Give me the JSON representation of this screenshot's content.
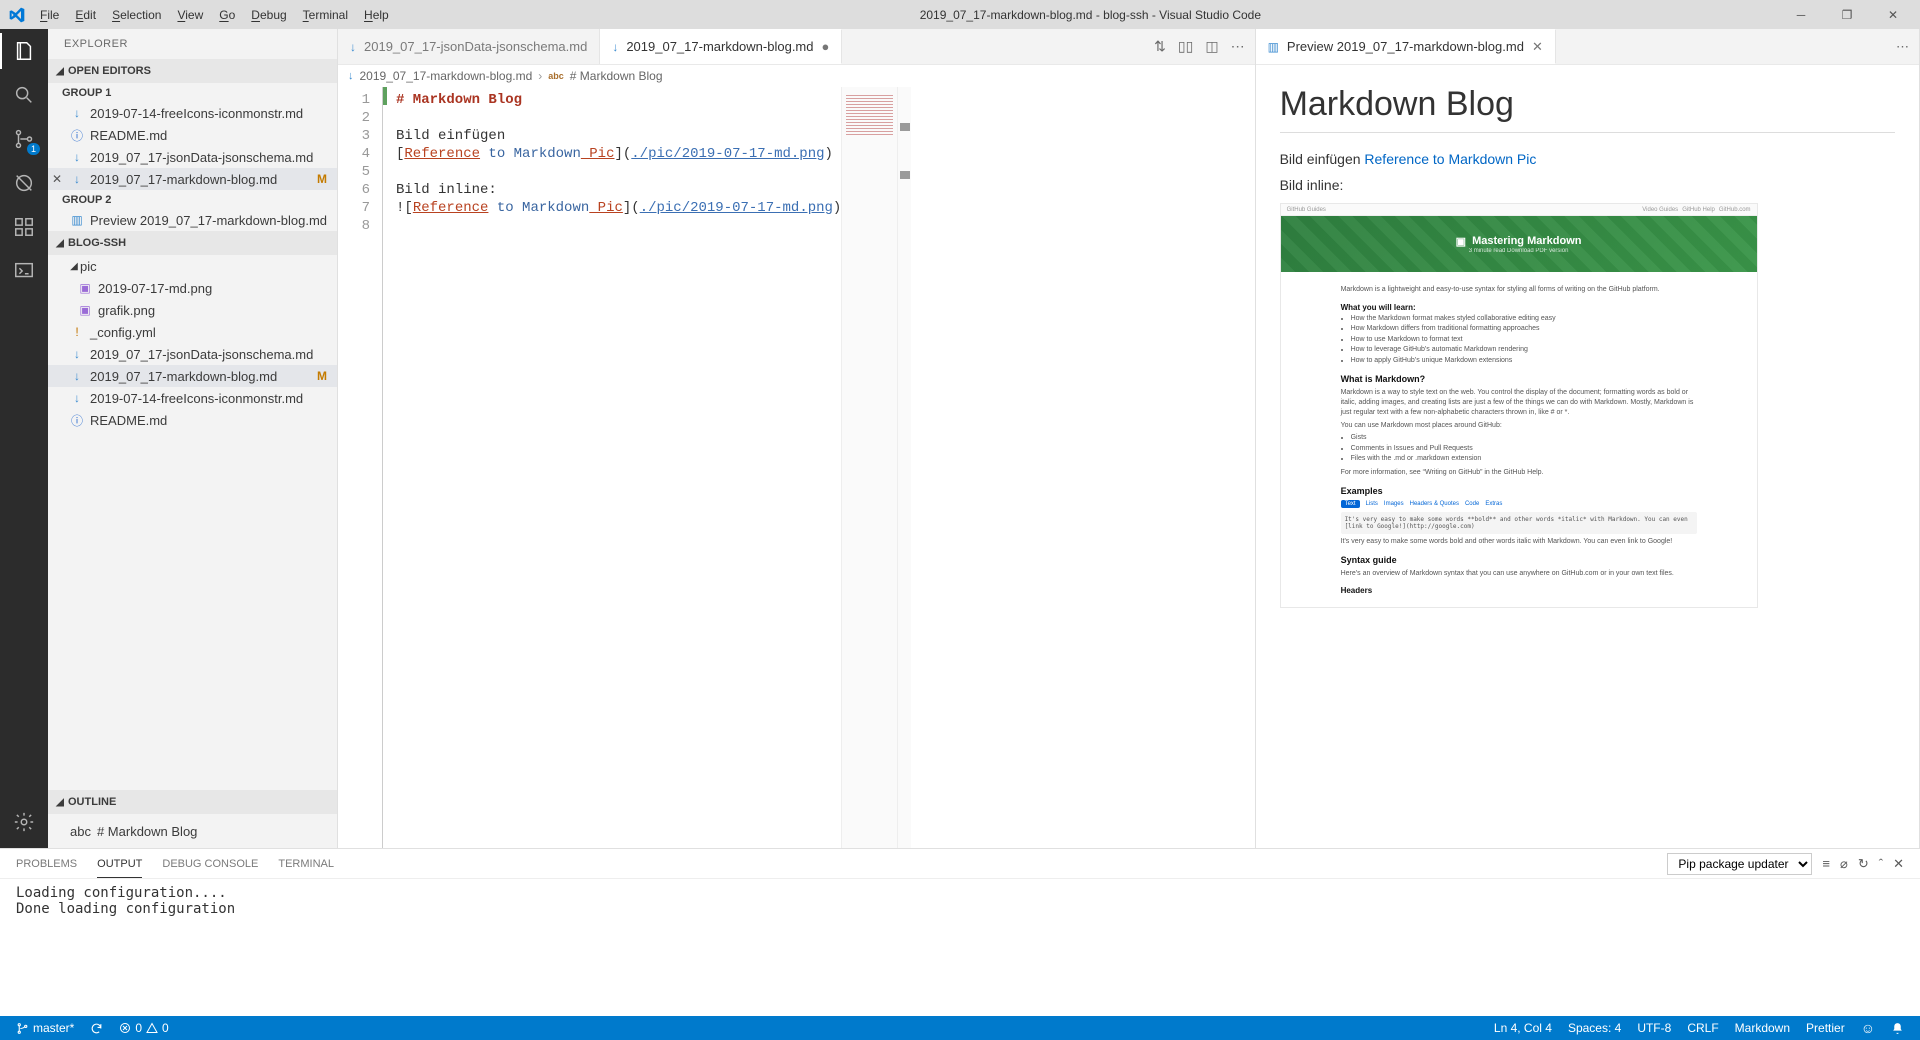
{
  "window": {
    "title": "2019_07_17-markdown-blog.md - blog-ssh - Visual Studio Code"
  },
  "menu": [
    "File",
    "Edit",
    "Selection",
    "View",
    "Go",
    "Debug",
    "Terminal",
    "Help"
  ],
  "activitybar": {
    "scm_badge": "1"
  },
  "sidebar": {
    "title": "EXPLORER",
    "sections": {
      "openEditors": "OPEN EDITORS",
      "blog": "BLOG-SSH",
      "outline": "OUTLINE"
    },
    "group1": "GROUP 1",
    "group2": "GROUP 2",
    "openEditorsItems": {
      "g1a": "2019-07-14-freeIcons-iconmonstr.md",
      "g1b": "README.md",
      "g1c": "2019_07_17-jsonData-jsonschema.md",
      "g1d": "2019_07_17-markdown-blog.md",
      "g2a": "Preview 2019_07_17-markdown-blog.md"
    },
    "tree": {
      "pic": "pic",
      "picA": "2019-07-17-md.png",
      "picB": "grafik.png",
      "config": "_config.yml",
      "fA": "2019_07_17-jsonData-jsonschema.md",
      "fB": "2019_07_17-markdown-blog.md",
      "fC": "2019-07-14-freeIcons-iconmonstr.md",
      "fD": "README.md"
    },
    "modBadge": "M",
    "outlineItem": "# Markdown Blog"
  },
  "editor": {
    "tabs": {
      "t1": "2019_07_17-jsonData-jsonschema.md",
      "t2": "2019_07_17-markdown-blog.md"
    },
    "tab2_dirty": "●",
    "breadcrumb": {
      "a": "2019_07_17-markdown-blog.md",
      "b": "# Markdown Blog"
    },
    "lines": {
      "l1": "# Markdown Blog",
      "l3": "Bild einfügen",
      "l4a": "[",
      "l4b": "Reference",
      "l4c": " to ",
      "l4d": "Markdown",
      "l4e": " Pic",
      "l4f": "](",
      "l4g": "./pic/2019-07-17-md.png",
      "l4h": ")",
      "l6": "Bild inline:",
      "l7a": "![",
      "l7b": "Reference",
      "l7c": " to ",
      "l7d": "Markdown",
      "l7e": " Pic",
      "l7f": "](",
      "l7g": "./pic/2019-07-17-md.png",
      "l7h": ")"
    },
    "linenumbers": [
      "1",
      "2",
      "3",
      "4",
      "5",
      "6",
      "7",
      "8"
    ]
  },
  "preview": {
    "tab": "Preview 2019_07_17-markdown-blog.md",
    "h1": "Markdown Blog",
    "p1a": "Bild einfügen ",
    "p1link": "Reference to Markdown Pic",
    "p2": "Bild inline:",
    "img": {
      "bannerTitle": "Mastering Markdown",
      "bannerSub": "3 minute read   Download PDF version",
      "intro": "Markdown is a lightweight and easy-to-use syntax for styling all forms of writing on the GitHub platform.",
      "wywl": "What you will learn:",
      "b1": "How the Markdown format makes styled collaborative editing easy",
      "b2": "How Markdown differs from traditional formatting approaches",
      "b3": "How to use Markdown to format text",
      "b4": "How to leverage GitHub’s automatic Markdown rendering",
      "b5": "How to apply GitHub’s unique Markdown extensions",
      "h_what": "What is Markdown?",
      "what_p": "Markdown is a way to style text on the web. You control the display of the document; formatting words as bold or italic, adding images, and creating lists are just a few of the things we can do with Markdown. Mostly, Markdown is just regular text with a few non-alphabetic characters thrown in, like # or *.",
      "where": "You can use Markdown most places around GitHub:",
      "w1": "Gists",
      "w2": "Comments in Issues and Pull Requests",
      "w3": "Files with the .md or .markdown extension",
      "more": "For more information, see “Writing on GitHub” in the GitHub Help.",
      "h_ex": "Examples",
      "tabs": [
        "Text",
        "Lists",
        "Images",
        "Headers & Quotes",
        "Code",
        "Extras"
      ],
      "codebox": "It's very easy to make some words **bold** and other words *italic* with Markdown. You can even [link to Google!](http://google.com)",
      "aftercode": "It's very easy to make some words bold and other words italic with Markdown. You can even link to Google!",
      "h_syntax": "Syntax guide",
      "syntax_p": "Here’s an overview of Markdown syntax that you can use anywhere on GitHub.com or in your own text files.",
      "h_headers": "Headers"
    }
  },
  "panel": {
    "tabs": {
      "problems": "PROBLEMS",
      "output": "OUTPUT",
      "debug": "DEBUG CONSOLE",
      "terminal": "TERMINAL"
    },
    "dropdown": "Pip package updater",
    "out1": "Loading configuration....",
    "out2": "Done loading configuration"
  },
  "statusbar": {
    "branch": "master*",
    "errors": "0",
    "warnings": "0",
    "pos": "Ln 4, Col 4",
    "spaces": "Spaces: 4",
    "encoding": "UTF-8",
    "eol": "CRLF",
    "lang": "Markdown",
    "prettier": "Prettier"
  }
}
